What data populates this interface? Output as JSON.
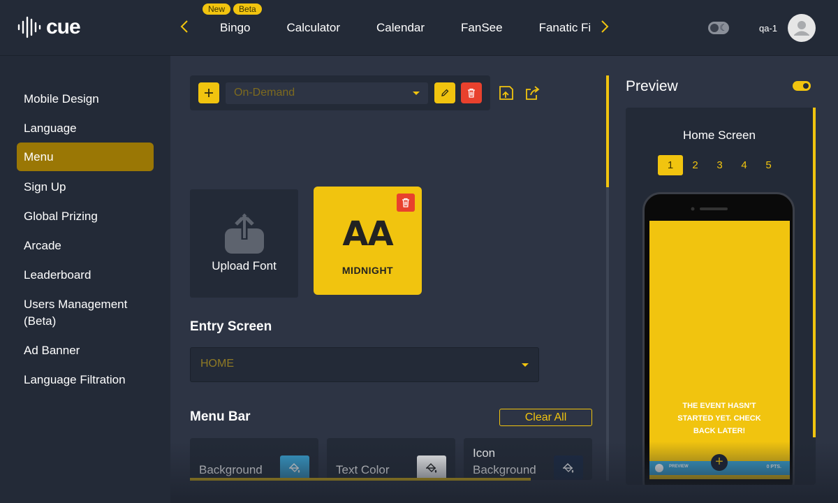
{
  "brand": {
    "logo_text": "cue",
    "accent": "#f1c40f",
    "danger": "#e8412d"
  },
  "topnav": {
    "tabs": [
      {
        "label": "Bingo",
        "badges": [
          "New",
          "Beta"
        ]
      },
      {
        "label": "Calculator"
      },
      {
        "label": "Calendar"
      },
      {
        "label": "FanSee"
      },
      {
        "label": "Fanatic Fi"
      }
    ],
    "username": "qa-1",
    "prev_icon": "chevron-left-icon",
    "next_icon": "chevron-right-icon",
    "theme_icon": "moon-icon"
  },
  "sidebar": {
    "items": [
      {
        "label": "Mobile Design"
      },
      {
        "label": "Language"
      },
      {
        "label": "Menu",
        "active": true
      },
      {
        "label": "Sign Up"
      },
      {
        "label": "Global Prizing"
      },
      {
        "label": "Arcade"
      },
      {
        "label": "Leaderboard"
      },
      {
        "label": "Users Management (Beta)"
      },
      {
        "label": "Ad Banner"
      },
      {
        "label": "Language Filtration"
      }
    ]
  },
  "toolbar": {
    "mode_value": "On-Demand",
    "icons": [
      "plus-icon",
      "pencil-icon",
      "trash-icon",
      "save-icon",
      "share-icon"
    ]
  },
  "fonts": {
    "upload_label": "Upload Font",
    "cards": [
      {
        "preview": "AA",
        "name": "MIDNIGHT"
      }
    ]
  },
  "entry_screen": {
    "title": "Entry Screen",
    "value": "HOME"
  },
  "menu_bar": {
    "title": "Menu Bar",
    "clear_label": "Clear All",
    "colors": [
      {
        "label": "Background",
        "color": "#3aa5d6"
      },
      {
        "label": "Text Color",
        "color": "#ffffff"
      },
      {
        "label": "Icon Background",
        "color": "#1b2a44"
      }
    ]
  },
  "preview": {
    "title": "Preview",
    "screen_name": "Home Screen",
    "pages": [
      "1",
      "2",
      "3",
      "4",
      "5"
    ],
    "active_page": "1",
    "message": "The Event hasn't started yet. Check back later!",
    "bar_left": "Preview",
    "bar_right": "0 pts."
  }
}
